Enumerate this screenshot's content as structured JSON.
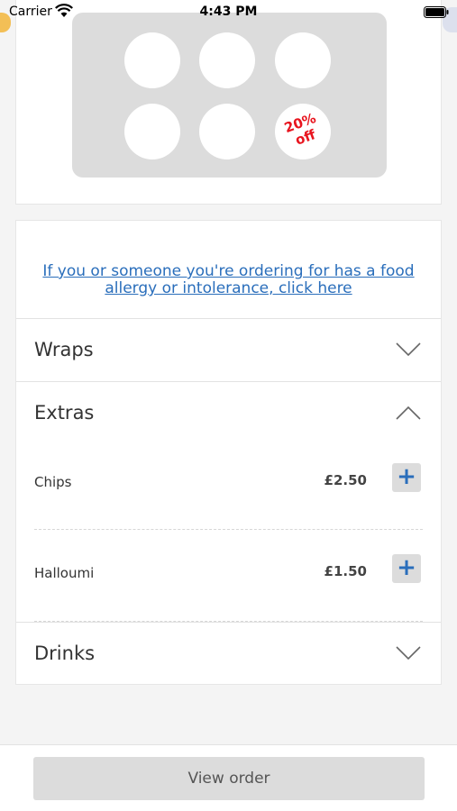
{
  "status_bar": {
    "carrier": "Carrier",
    "time": "4:43 PM",
    "wifi_icon": "wifi-icon",
    "battery_icon": "battery-icon"
  },
  "loyalty_card": {
    "stamps_total": 6,
    "discount_lines": [
      "20%",
      "off"
    ],
    "discount_color": "#e8141e"
  },
  "menu": {
    "allergy_link": "If you or someone you're ordering for has a food allergy or intolerance, click here",
    "link_color": "#2a6ebb",
    "sections": [
      {
        "title": "Wraps",
        "expanded": false,
        "chevron_icon": "chevron-down-icon"
      },
      {
        "title": "Extras",
        "expanded": true,
        "chevron_icon": "chevron-up-icon",
        "items": [
          {
            "name": "Chips",
            "price": "£2.50",
            "add_label": "+"
          },
          {
            "name": "Halloumi",
            "price": "£1.50",
            "add_label": "+"
          }
        ]
      },
      {
        "title": "Drinks",
        "expanded": false,
        "chevron_icon": "chevron-down-icon"
      }
    ]
  },
  "footer": {
    "view_order_label": "View order"
  }
}
